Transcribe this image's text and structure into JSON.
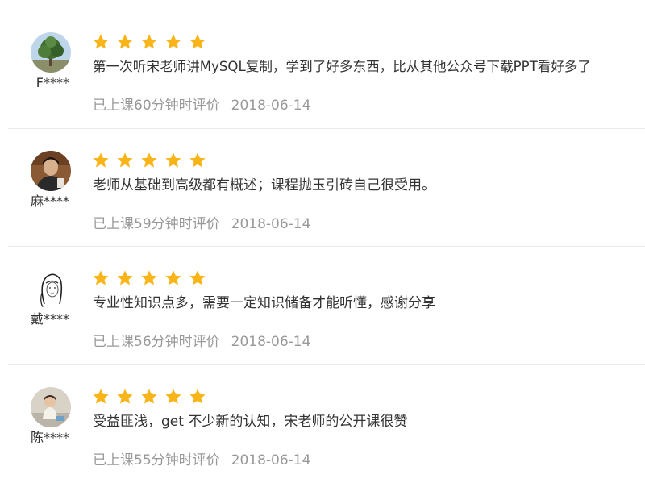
{
  "accent": {
    "star_color": "#f9b417",
    "text_color": "#333333",
    "meta_color": "#999999"
  },
  "reviews": [
    {
      "username": "F****",
      "avatar": "tree-photo-avatar",
      "rating": 5,
      "comment": "第一次听宋老师讲MySQL复制，学到了好多东西，比从其他公众号下载PPT看好多了",
      "study_time": "已上课60分钟时评价",
      "date": "2018-06-14"
    },
    {
      "username": "麻****",
      "avatar": "person-photo-avatar",
      "rating": 5,
      "comment": "老师从基础到高级都有概述；课程抛玉引砖自己很受用。",
      "study_time": "已上课59分钟时评价",
      "date": "2018-06-14"
    },
    {
      "username": "戴****",
      "avatar": "sketch-girl-avatar",
      "rating": 5,
      "comment": "专业性知识点多，需要一定知识储备才能听懂，感谢分享",
      "study_time": "已上课56分钟时评价",
      "date": "2018-06-14"
    },
    {
      "username": "陈****",
      "avatar": "child-photo-avatar",
      "rating": 5,
      "comment": "受益匪浅，get 不少新的认知，宋老师的公开课很赞",
      "study_time": "已上课55分钟时评价",
      "date": "2018-06-14"
    }
  ]
}
